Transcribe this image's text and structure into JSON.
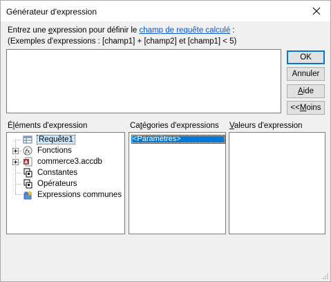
{
  "window": {
    "title": "Générateur d'expression"
  },
  "instructions": {
    "line1_before": "Entrez une ",
    "line1_u": "e",
    "line1_after_u": "xpression pour définir le ",
    "line1_link": "champ de requête calculé",
    "line1_end": " :",
    "line2": "(Exemples d'expressions : [champ1] + [champ2] et [champ1] < 5)"
  },
  "expression": {
    "value": ""
  },
  "buttons": {
    "ok": "OK",
    "cancel": "Annuler",
    "help_u": "A",
    "help_rest": "ide",
    "less_before": "<< ",
    "less_u": "M",
    "less_rest": "oins"
  },
  "elements_panel": {
    "label_before": "É",
    "label_u": "l",
    "label_after": "éments d'expression",
    "items": [
      {
        "label": "Requête1",
        "icon": "query-icon",
        "expandable": false,
        "selected": true
      },
      {
        "label": "Fonctions",
        "icon": "function-fx-icon",
        "expandable": true,
        "selected": false
      },
      {
        "label": "commerce3.accdb",
        "icon": "access-database-icon",
        "expandable": true,
        "selected": false
      },
      {
        "label": "Constantes",
        "icon": "constants-folder-icon",
        "expandable": false,
        "selected": false
      },
      {
        "label": "Opérateurs",
        "icon": "operators-folder-icon",
        "expandable": false,
        "selected": false
      },
      {
        "label": "Expressions communes",
        "icon": "common-expressions-icon",
        "expandable": false,
        "selected": false
      }
    ]
  },
  "categories_panel": {
    "label_before": "Ca",
    "label_u": "t",
    "label_after": "égories d'expressions",
    "items": [
      {
        "label": "<Paramètres>",
        "selected": true
      }
    ]
  },
  "values_panel": {
    "label_before": "",
    "label_u": "V",
    "label_after": "aleurs d'expression",
    "items": []
  },
  "colors": {
    "accent": "#0078d7",
    "link": "#0b57d0",
    "selection_light": "#cce8ff"
  }
}
